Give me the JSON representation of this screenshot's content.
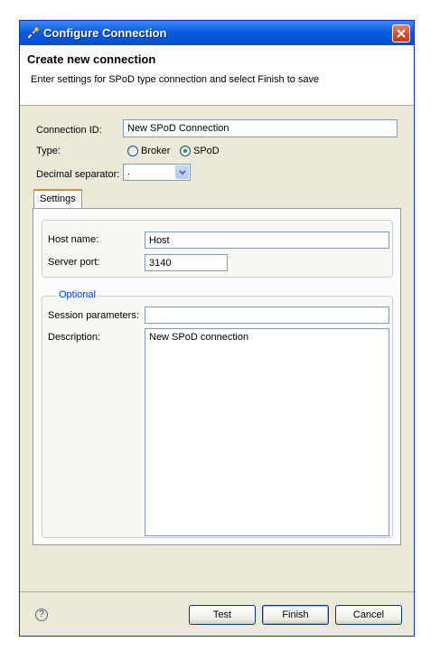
{
  "window": {
    "title": "Configure Connection"
  },
  "banner": {
    "title": "Create new connection",
    "message": "Enter settings for SPoD type connection and select Finish to save"
  },
  "form": {
    "connection_id_label": "Connection ID:",
    "connection_id_value": "New SPoD Connection",
    "type_label": "Type:",
    "type_options": [
      "Broker",
      "SPoD"
    ],
    "type_selected": "SPoD",
    "decimal_label": "Decimal separator:",
    "decimal_value": "."
  },
  "tabs": [
    {
      "label": "Settings",
      "selected": true
    }
  ],
  "settings": {
    "host_label": "Host name:",
    "host_value": "Host",
    "port_label": "Server port:",
    "port_value": "3140"
  },
  "optional": {
    "legend": "Optional",
    "session_label": "Session parameters:",
    "session_value": "",
    "description_label": "Description:",
    "description_value": "New SPoD connection"
  },
  "footer": {
    "help_icon": "?",
    "test_label": "Test",
    "finish_label": "Finish",
    "cancel_label": "Cancel"
  },
  "colors": {
    "title_bar": "#0a5ee0",
    "dialog_bg": "#ece9d8",
    "tab_accent": "#e68b2c",
    "legend_text": "#0046d5"
  }
}
